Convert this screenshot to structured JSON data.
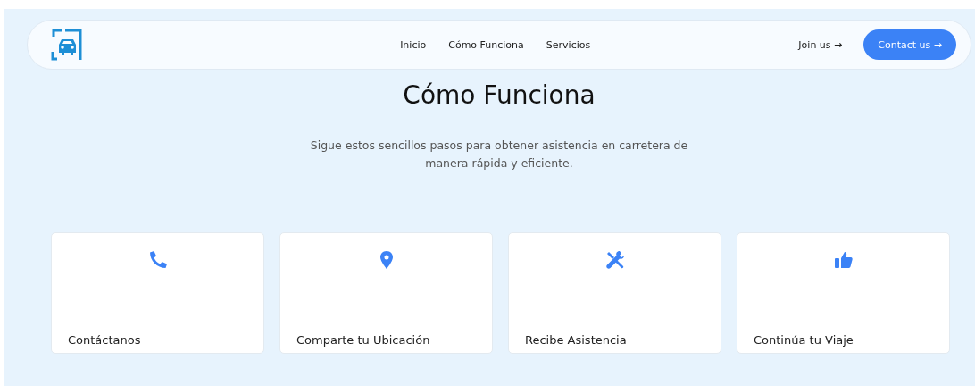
{
  "nav": {
    "links": [
      "Inicio",
      "Cómo Funciona",
      "Servicios"
    ],
    "join": "Join us",
    "join_arrow": "→",
    "contact": "Contact us",
    "contact_arrow": "→"
  },
  "title": "Cómo Funciona",
  "subtitle": "Sigue estos sencillos pasos para obtener asistencia en carretera de manera rápida y eficiente.",
  "steps": [
    {
      "kind": "phone",
      "label": "Contáctanos"
    },
    {
      "kind": "pin",
      "label": "Comparte tu Ubicación"
    },
    {
      "kind": "tools",
      "label": "Recibe Asistencia"
    },
    {
      "kind": "thumb",
      "label": "Continúa tu Viaje"
    }
  ]
}
